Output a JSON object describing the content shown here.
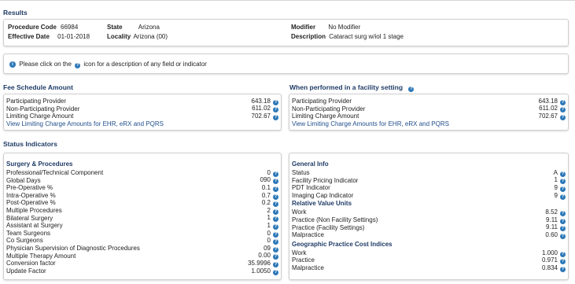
{
  "results": {
    "title": "Results",
    "procedure_code_label": "Procedure Code",
    "procedure_code_value": "66984",
    "effective_date_label": "Effective Date",
    "effective_date_value": "01-01-2018",
    "state_label": "State",
    "state_value": "Arizona",
    "locality_label": "Locality",
    "locality_value": "Arizona (00)",
    "modifier_label": "Modifier",
    "modifier_value": "No Modifier",
    "description_label": "Description",
    "description_value": "Cataract surg w/iol 1 stage"
  },
  "info": {
    "text_before": "Please click on the",
    "text_after": "icon for a description of any field or indicator"
  },
  "fee_schedule": {
    "title": "Fee Schedule Amount",
    "rows": [
      {
        "label": "Participating Provider",
        "value": "643.18"
      },
      {
        "label": "Non-Participating Provider",
        "value": "611.02"
      },
      {
        "label": "Limiting Charge Amount",
        "value": "702.67"
      }
    ],
    "link": "View Limiting Charge Amounts for EHR, eRX and PQRS"
  },
  "facility": {
    "title": "When performed in a facility setting",
    "rows": [
      {
        "label": "Participating Provider",
        "value": "643.18"
      },
      {
        "label": "Non-Participating Provider",
        "value": "611.02"
      },
      {
        "label": "Limiting Charge Amount",
        "value": "702.67"
      }
    ],
    "link": "View Limiting Charge Amounts for EHR, eRX and PQRS"
  },
  "status": {
    "title": "Status Indicators",
    "surgery": {
      "title": "Surgery & Procedures",
      "rows": [
        {
          "label": "Professional/Technical Component",
          "value": "0"
        },
        {
          "label": "Global Days",
          "value": "090"
        },
        {
          "label": "Pre-Operative %",
          "value": "0.1"
        },
        {
          "label": "Intra-Operative %",
          "value": "0.7"
        },
        {
          "label": "Post-Operative %",
          "value": "0.2"
        },
        {
          "label": "Multiple Procedures",
          "value": "2"
        },
        {
          "label": "Bilateral Surgery",
          "value": "1"
        },
        {
          "label": "Assistant at Surgery",
          "value": "1"
        },
        {
          "label": "Team Surgeons",
          "value": "0"
        },
        {
          "label": "Co Surgeons",
          "value": "0"
        },
        {
          "label": "Physician Supervision of Diagnostic Procedures",
          "value": "09"
        },
        {
          "label": "Multiple Therapy Amount",
          "value": "0.00"
        },
        {
          "label": "Conversion factor",
          "value": "35.9996"
        },
        {
          "label": "Update Factor",
          "value": "1.0050"
        }
      ]
    },
    "general": {
      "title": "General Info",
      "rows": [
        {
          "label": "Status",
          "value": "A"
        },
        {
          "label": "Facility Pricing Indicator",
          "value": "1"
        },
        {
          "label": "PDT Indicator",
          "value": "9"
        },
        {
          "label": "Imaging Cap Indicator",
          "value": "9"
        }
      ]
    },
    "rvu": {
      "title": "Relative Value Units",
      "rows": [
        {
          "label": "Work",
          "value": "8.52"
        },
        {
          "label": "Practice (Non Facility Settings)",
          "value": "9.11"
        },
        {
          "label": "Practice (Facility Settings)",
          "value": "9.11"
        },
        {
          "label": "Malpractice",
          "value": "0.60"
        }
      ]
    },
    "gpci": {
      "title": "Geographic Practice Cost Indices",
      "rows": [
        {
          "label": "Work",
          "value": "1.000"
        },
        {
          "label": "Practice",
          "value": "0.971"
        },
        {
          "label": "Malpractice",
          "value": "0.834"
        }
      ]
    }
  },
  "colors": {
    "heading": "#1f3c66",
    "help_icon": "#2d78b7",
    "link": "#1f4e8c",
    "border": "#cfcfcf"
  }
}
